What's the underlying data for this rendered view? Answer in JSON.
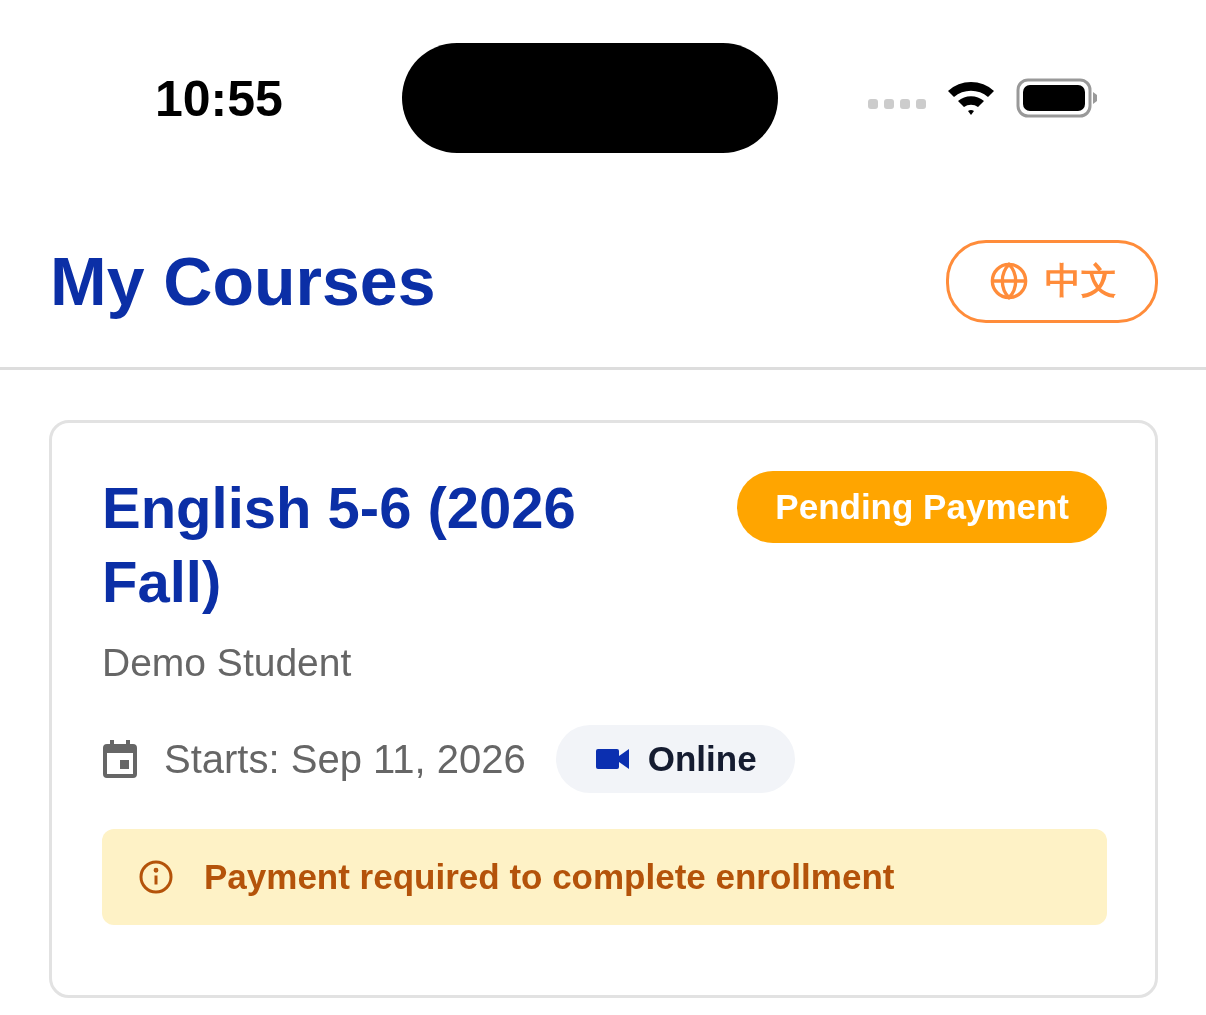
{
  "status_bar": {
    "time": "10:55"
  },
  "header": {
    "title": "My Courses",
    "language_button": "中文"
  },
  "courses": [
    {
      "title": "English 5-6 (2026 Fall)",
      "status": {
        "label": "Pending Payment",
        "kind": "pending"
      },
      "student": "Demo Student",
      "start": "Starts: Sep 11, 2026",
      "mode": {
        "label": "Online",
        "kind": "online"
      },
      "notice": {
        "text": "Payment required to complete enrollment",
        "kind": "warning"
      }
    }
  ]
}
